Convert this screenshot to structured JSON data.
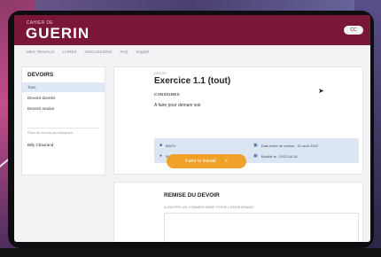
{
  "header": {
    "brand_sub": "CAHIER DE",
    "brand": "GUERIN",
    "pill": "CC"
  },
  "nav": [
    "MES TRAVAUX",
    "LIVRES",
    "DISCUSSIONS",
    "FAQ",
    "English"
  ],
  "sidebar": {
    "title": "DEVOIRS",
    "items": [
      {
        "label": "Tous",
        "active": true
      },
      {
        "label": "Devoirs donnés",
        "active": false
      },
      {
        "label": "Devoirs rendus",
        "active": false
      }
    ],
    "hint": "Filtrer les devoirs par enseignant",
    "user": "Billy Chaurand"
  },
  "assignment": {
    "crumb": "DEVOIR",
    "title": "Exercice 1.1 (tout)",
    "consignes_label": "CONSIGNES",
    "description": "A faire pour demain soir",
    "info": {
      "course": "MATH",
      "teacher": "Billy Chaurand",
      "due": "Date limite de remise : 31 août 2022",
      "modified": "Modifié le : 2022-08-18"
    },
    "button": "Faire le travail",
    "button_arrow": ">"
  },
  "submission": {
    "title": "REMISE DU DEVOIR",
    "comment_label": "AJOUTER UN COMMENTAIRE POUR L'ENSEIGNANT"
  },
  "colors": {
    "brand": "#7a1638",
    "accent": "#f0a12a",
    "info_bg": "#dce6f3"
  }
}
